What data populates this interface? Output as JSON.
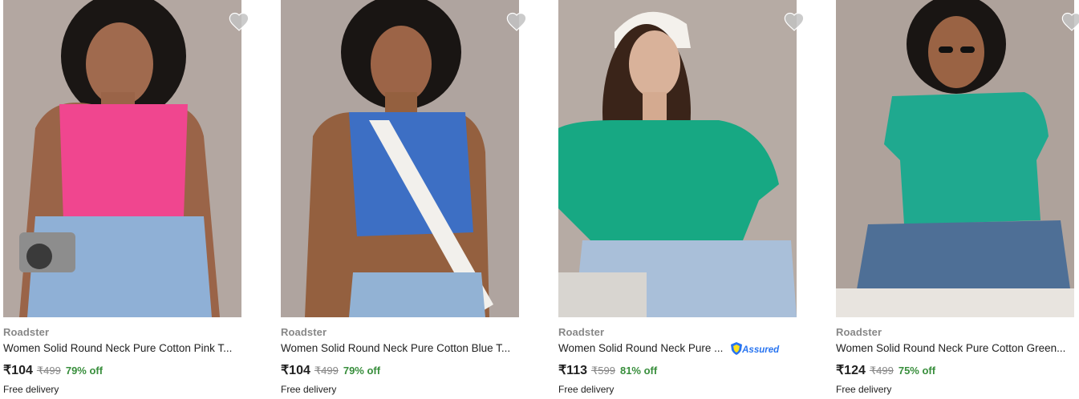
{
  "products": [
    {
      "brand": "Roadster",
      "title": "Women Solid Round Neck Pure Cotton Pink T...",
      "price": "₹104",
      "mrp": "₹499",
      "discount": "79% off",
      "delivery": "Free delivery",
      "image_alt": "woman in pink sleeveless crop top holding a camera",
      "top_color": "#f0468f",
      "assured": false
    },
    {
      "brand": "Roadster",
      "title": "Women Solid Round Neck Pure Cotton Blue T...",
      "price": "₹104",
      "mrp": "₹499",
      "discount": "79% off",
      "delivery": "Free delivery",
      "image_alt": "woman in blue sleeveless crop top with white bag strap",
      "top_color": "#3d6fc4",
      "assured": false
    },
    {
      "brand": "Roadster",
      "title": "Women Solid Round Neck Pure ...",
      "price": "₹113",
      "mrp": "₹599",
      "discount": "81% off",
      "delivery": "Free delivery",
      "assured_label": "Assured",
      "image_alt": "woman in green crop t-shirt and white cap",
      "top_color": "#17a883",
      "assured": true
    },
    {
      "brand": "Roadster",
      "title": "Women Solid Round Neck Pure Cotton Green...",
      "price": "₹124",
      "mrp": "₹499",
      "discount": "75% off",
      "delivery": "Free delivery",
      "image_alt": "woman in green crop t-shirt wearing sunglasses",
      "top_color": "#1fa98f",
      "assured": false
    }
  ],
  "colors": {
    "price": "#212121",
    "mrp": "#878787",
    "discount": "#388e3c",
    "assured": "#2874f0",
    "wishlist_icon": "#c2c2c2"
  },
  "icons": {
    "wishlist": "heart-icon",
    "assured": "flipkart-assured-badge-icon"
  }
}
